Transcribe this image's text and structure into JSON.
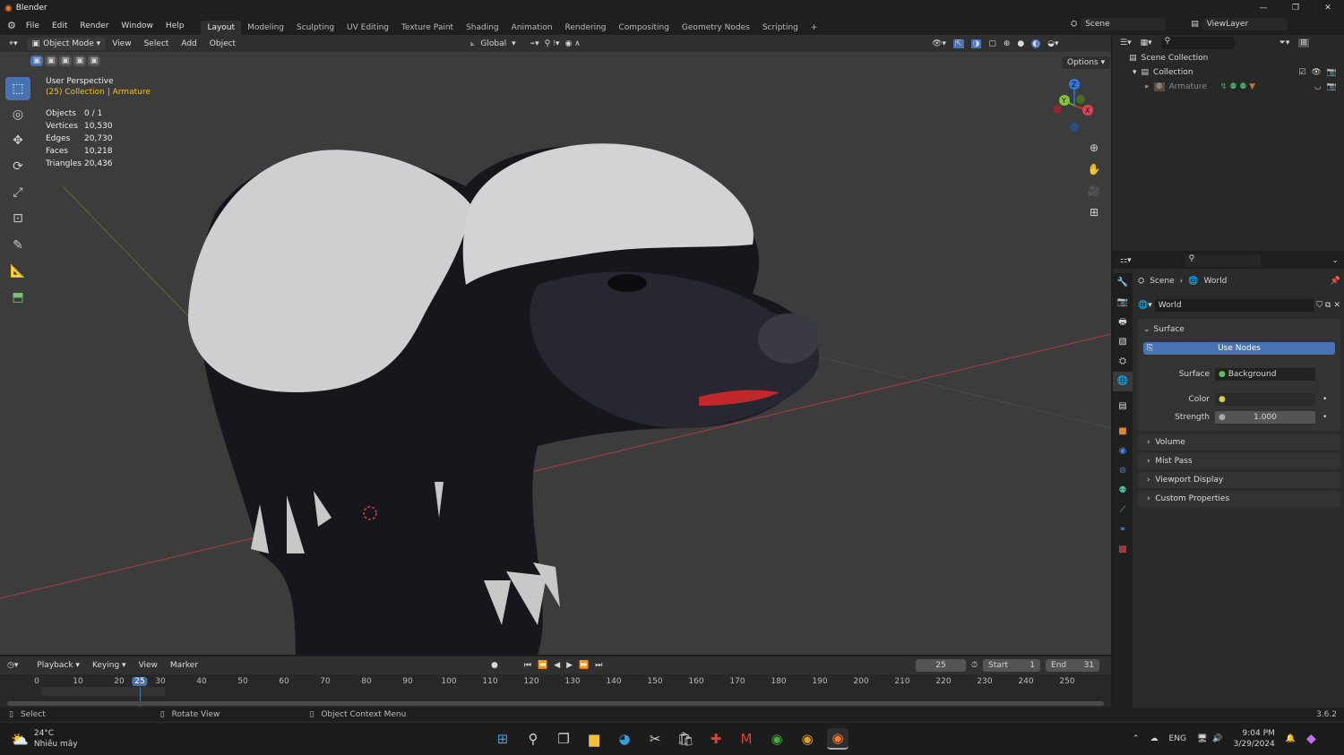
{
  "window": {
    "title": "Blender",
    "controls": [
      "—",
      "❐",
      "✕"
    ]
  },
  "menu": [
    "File",
    "Edit",
    "Render",
    "Window",
    "Help"
  ],
  "workspaces": [
    "Layout",
    "Modeling",
    "Sculpting",
    "UV Editing",
    "Texture Paint",
    "Shading",
    "Animation",
    "Rendering",
    "Compositing",
    "Geometry Nodes",
    "Scripting",
    "+"
  ],
  "scene": "Scene",
  "view_layer": "ViewLayer",
  "viewport_header": {
    "mode": "Object Mode",
    "menus": [
      "View",
      "Select",
      "Add",
      "Object"
    ],
    "orientation": "Global",
    "options": "Options"
  },
  "overlay": {
    "view_name": "User Perspective",
    "collection": "(25) Collection | Armature",
    "stats": [
      {
        "label": "Objects",
        "value": "0 / 1"
      },
      {
        "label": "Vertices",
        "value": "10,530"
      },
      {
        "label": "Edges",
        "value": "20,730"
      },
      {
        "label": "Faces",
        "value": "10,218"
      },
      {
        "label": "Triangles",
        "value": "20,436"
      }
    ]
  },
  "gizmo": {
    "x": "X",
    "y": "Y",
    "z": "Z"
  },
  "outliner": {
    "items": [
      {
        "label": "Scene Collection"
      },
      {
        "label": "Collection"
      },
      {
        "label": "Armature"
      }
    ]
  },
  "properties": {
    "breadcrumb": [
      "Scene",
      "World"
    ],
    "world_name": "World",
    "surface_panel": "Surface",
    "use_nodes": "Use Nodes",
    "surface_label": "Surface",
    "surface_value": "Background",
    "color_label": "Color",
    "strength_label": "Strength",
    "strength_value": "1.000",
    "panels": [
      "Volume",
      "Mist Pass",
      "Viewport Display",
      "Custom Properties"
    ]
  },
  "timeline": {
    "menus": [
      "Playback",
      "Keying",
      "View",
      "Marker"
    ],
    "current_frame": "25",
    "start_label": "Start",
    "start": "1",
    "end_label": "End",
    "end": "31",
    "ticks": [
      "0",
      "10",
      "20",
      "25",
      "30",
      "40",
      "50",
      "60",
      "70",
      "80",
      "90",
      "100",
      "110",
      "120",
      "130",
      "140",
      "150",
      "160",
      "170",
      "180",
      "190",
      "200",
      "210",
      "220",
      "230",
      "240",
      "250"
    ]
  },
  "status": {
    "items": [
      "Select",
      "Rotate View",
      "Object Context Menu"
    ],
    "version": "3.6.2"
  },
  "taskbar": {
    "weather_temp": "24°C",
    "weather_desc": "Nhiều mây",
    "lang": "ENG",
    "time": "9:04 PM",
    "date": "3/29/2024"
  },
  "colors": {
    "accent": "#4772b3",
    "frame_marker": "#4772b3",
    "x_axis": "#b53b3b",
    "y_axis": "#6f8a2c"
  }
}
